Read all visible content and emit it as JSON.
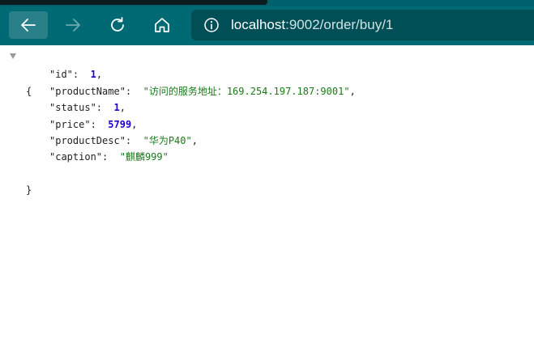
{
  "browser": {
    "url_host": "localhost",
    "url_rest": ":9002/order/buy/1",
    "icons": {
      "back": "arrow-left-icon",
      "forward": "arrow-right-icon",
      "refresh": "refresh-icon",
      "home": "home-icon",
      "site_info": "info-icon"
    }
  },
  "json": {
    "open_brace": "{",
    "close_brace": "}",
    "entries": [
      {
        "key": "\"id\"",
        "value": "1",
        "type": "number",
        "comma": ","
      },
      {
        "key": "\"productName\"",
        "value": "\"访问的服务地址：169.254.197.187:9001\"",
        "type": "string",
        "comma": ","
      },
      {
        "key": "\"status\"",
        "value": "1",
        "type": "number",
        "comma": ","
      },
      {
        "key": "\"price\"",
        "value": "5799",
        "type": "number",
        "comma": ","
      },
      {
        "key": "\"productDesc\"",
        "value": "\"华为P40\"",
        "type": "string",
        "comma": ","
      },
      {
        "key": "\"caption\"",
        "value": "\"麒麟999\"",
        "type": "string",
        "comma": ""
      }
    ]
  },
  "colors": {
    "toolbar": "#006a74",
    "address_bar": "#004e56",
    "string": "#1a7a1a",
    "number": "#1c00cf"
  }
}
